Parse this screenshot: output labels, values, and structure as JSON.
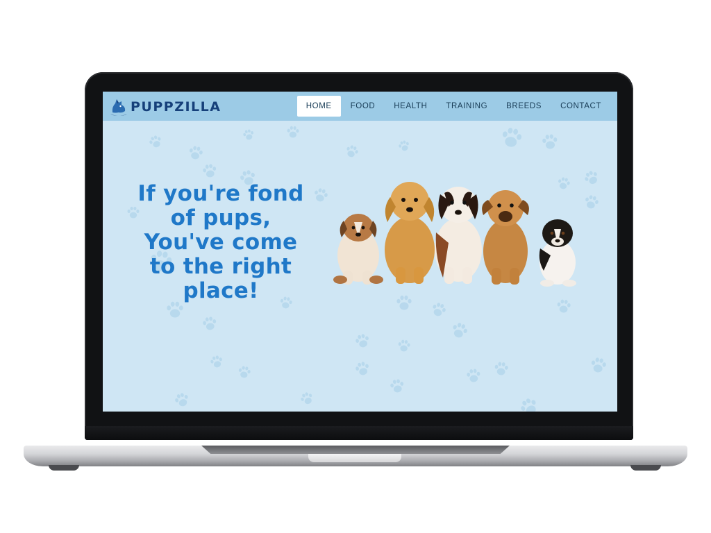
{
  "site": {
    "brand": "PUPPZILLA",
    "brand_color": "#16407a",
    "accent": "#1f78c8",
    "navbar_bg": "#9ccbe6",
    "page_bg": "#cfe6f4"
  },
  "nav": {
    "items": [
      {
        "label": "HOME",
        "active": true
      },
      {
        "label": "FOOD",
        "active": false
      },
      {
        "label": "HEALTH",
        "active": false
      },
      {
        "label": "TRAINING",
        "active": false
      },
      {
        "label": "BREEDS",
        "active": false
      },
      {
        "label": "CONTACT",
        "active": false
      }
    ]
  },
  "hero": {
    "headline_lines": [
      "If you're fond",
      "of pups,",
      "You've come",
      "to the right",
      "place!"
    ],
    "image": "five-puppies-sitting-in-a-row"
  },
  "icons": {
    "logo": "dog-head-logo-icon",
    "background": "paw-print-icon"
  }
}
